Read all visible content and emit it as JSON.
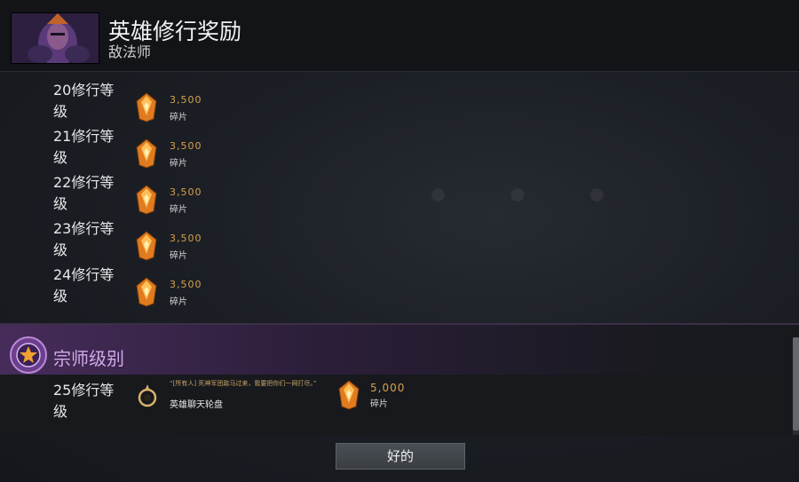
{
  "header": {
    "title": "英雄修行奖励",
    "hero_name": "敌法师"
  },
  "background_hint_text": "",
  "rewards": [
    {
      "level": "20修行等级",
      "amount": "3,500",
      "unit": "碎片"
    },
    {
      "level": "21修行等级",
      "amount": "3,500",
      "unit": "碎片"
    },
    {
      "level": "22修行等级",
      "amount": "3,500",
      "unit": "碎片"
    },
    {
      "level": "23修行等级",
      "amount": "3,500",
      "unit": "碎片"
    },
    {
      "level": "24修行等级",
      "amount": "3,500",
      "unit": "碎片"
    }
  ],
  "grandmaster": {
    "title": "宗师级别",
    "level": "25修行等级",
    "chat_wheel": {
      "quote": "“[所有人] 死神军团敌马过来，我要把你们一网打尽。”",
      "name": "英雄聊天轮盘"
    },
    "shards": {
      "amount": "5,000",
      "unit": "碎片"
    }
  },
  "buttons": {
    "ok": "好的"
  },
  "colors": {
    "shard_amount": "#d7a04a",
    "grandmaster_accent": "#d2a9ea",
    "header_bg": "#121417"
  },
  "icons": {
    "shard": "orange-shard-icon",
    "chat_wheel": "chat-wheel-icon",
    "grandmaster": "grandmaster-badge-icon"
  }
}
